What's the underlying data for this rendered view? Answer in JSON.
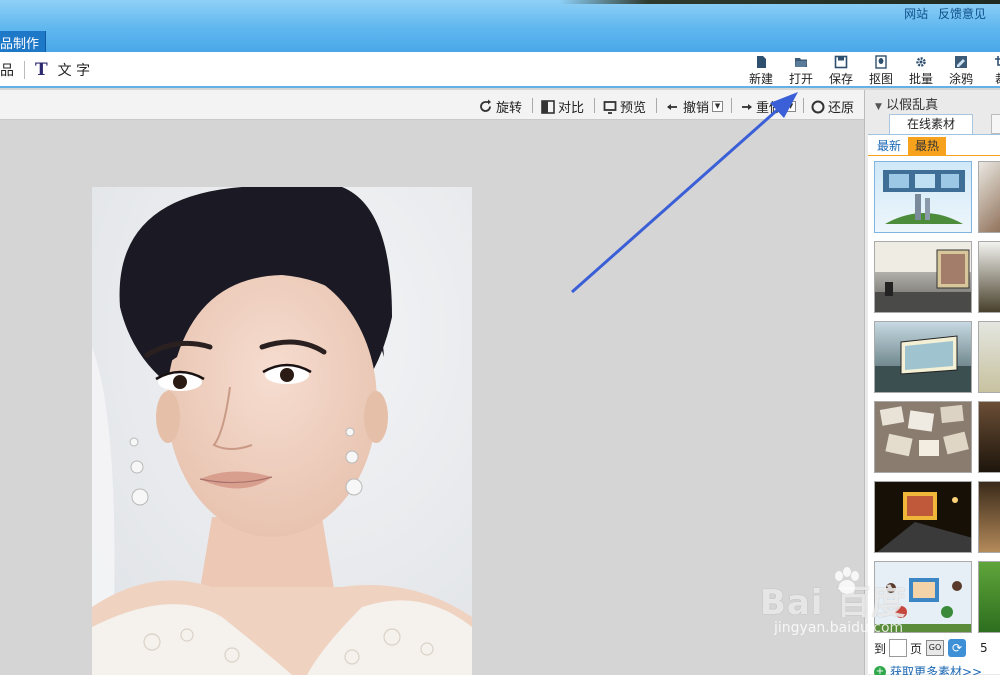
{
  "header": {
    "links": [
      "网站",
      "反馈意见"
    ],
    "active_tab": "品制作"
  },
  "tool_row": {
    "left_item": "品",
    "text_tool_icon": "T",
    "text_tool_label": "文 字",
    "buttons": [
      "新建",
      "打开",
      "保存",
      "抠图",
      "批量",
      "涂鸦",
      "裁"
    ]
  },
  "canvas_toolbar": {
    "rotate": "旋转",
    "compare": "对比",
    "preview": "预览",
    "undo": "撤销",
    "redo": "重做",
    "restore": "还原"
  },
  "right_panel": {
    "section_title": "以假乱真",
    "tab_online": "在线素材",
    "subtab_newest": "最新",
    "subtab_hottest": "最热",
    "pager_to": "到",
    "pager_page": "页",
    "pager_go": "GO",
    "pager_count": "5",
    "more_link": "获取更多素材>>"
  },
  "watermark": {
    "logo": "Bai  百度",
    "domain": "jingyan.baidu.com"
  },
  "colors": {
    "header_blue": "#5fb7ef",
    "tab_blue": "#1e78c8",
    "accent_orange": "#f7a21d",
    "arrow_blue": "#3a5fd6"
  }
}
